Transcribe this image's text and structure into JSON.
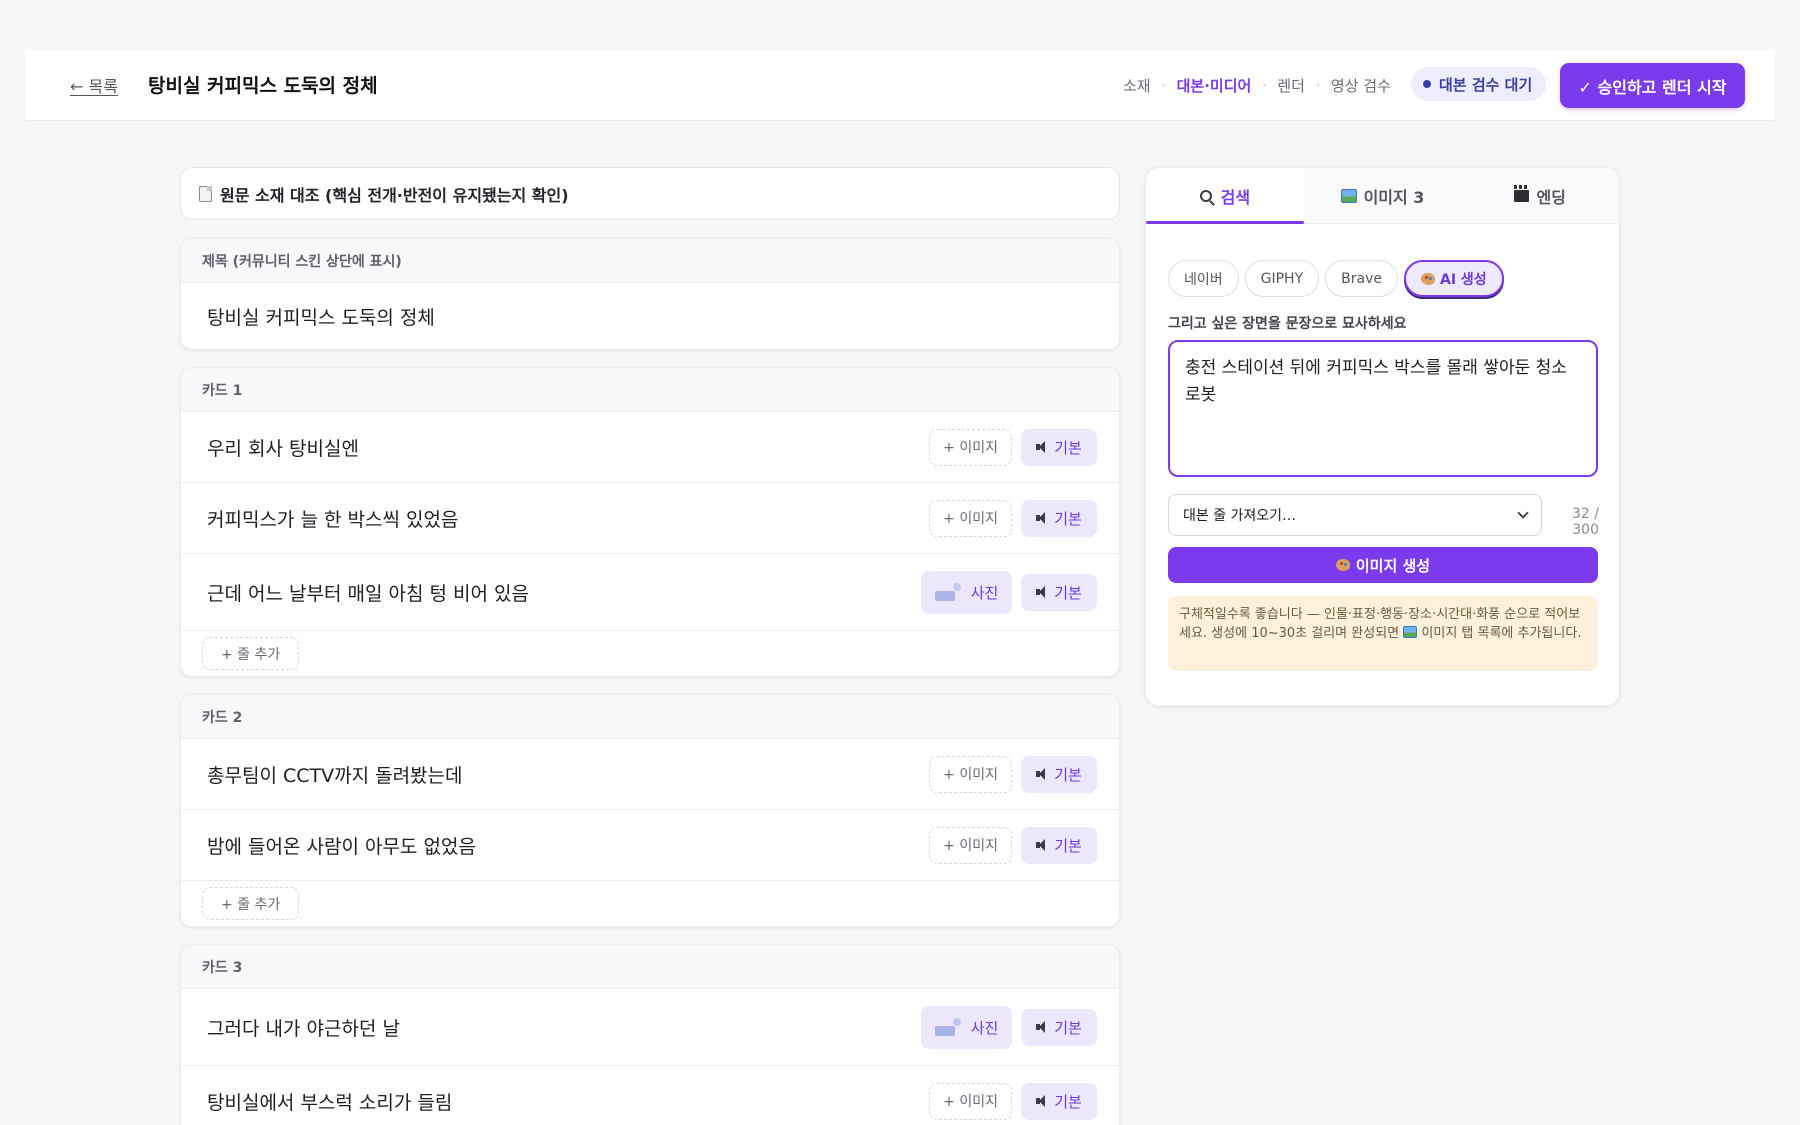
{
  "header": {
    "back_label": "← 목록",
    "title": "탕비실 커피믹스 도둑의 정체",
    "steps": [
      "소재",
      "대본·미디어",
      "렌더",
      "영상 검수"
    ],
    "active_step": "대본·미디어",
    "status": "대본 검수 대기",
    "approve_label": "✓ 승인하고 렌더 시작"
  },
  "source_compare": {
    "label": "원문 소재 대조 (핵심 전개·반전이 유지됐는지 확인)",
    "icon": "document-icon"
  },
  "title_card": {
    "header": "제목 (커뮤니티 스킨 상단에 표시)",
    "value": "탕비실 커피믹스 도둑의 정체"
  },
  "cards": [
    {
      "header": "카드 1",
      "lines": [
        {
          "text": "우리 회사 탕비실엔",
          "media": "+ 이미지",
          "voice": "기본"
        },
        {
          "text": "커피믹스가 늘 한 박스씩 있었음",
          "media": "+ 이미지",
          "voice": "기본"
        },
        {
          "text": "근데 어느 날부터 매일 아침 텅 비어 있음",
          "media": "사진",
          "voice": "기본"
        }
      ],
      "add_label": "+ 줄 추가"
    },
    {
      "header": "카드 2",
      "lines": [
        {
          "text": "총무팀이 CCTV까지 돌려봤는데",
          "media": "+ 이미지",
          "voice": "기본"
        },
        {
          "text": "밤에 들어온 사람이 아무도 없었음",
          "media": "+ 이미지",
          "voice": "기본"
        }
      ],
      "add_label": "+ 줄 추가"
    },
    {
      "header": "카드 3",
      "lines": [
        {
          "text": "그러다 내가 야근하던 날",
          "media": "사진",
          "voice": "기본"
        },
        {
          "text": "탕비실에서 부스럭 소리가 들림",
          "media": "+ 이미지",
          "voice": "기본"
        }
      ]
    }
  ],
  "panel": {
    "tabs": [
      {
        "label": "검색",
        "icon": "search-icon"
      },
      {
        "label": "이미지 3",
        "icon": "image-icon"
      },
      {
        "label": "엔딩",
        "icon": "clapper-icon"
      }
    ],
    "active_tab": "검색",
    "sources": [
      "네이버",
      "GIPHY",
      "Brave",
      "AI 생성"
    ],
    "active_source": "AI 생성",
    "prompt_label": "그리고 싶은 장면을 문장으로 묘사하세요",
    "prompt_value": "충전 스테이션 뒤에 커피믹스 박스를 몰래 쌓아둔 청소 로봇",
    "line_select": "대본 줄 가져오기…",
    "char_count": "32 / 300",
    "generate_label": "이미지 생성",
    "hint_before": "구체적일수록 좋습니다 — 인물·표정·행동·장소·시간대·화풍 순으로 적어보세요. 생성에 10~30초 걸리며 완성되면 ",
    "hint_after": " 이미지 탭 목록에 추가됩니다."
  },
  "colors": {
    "accent": "#7c3aed",
    "accent_soft": "#ede7fc",
    "status": "#3b3fa6",
    "hint_bg": "#fdf1dc"
  }
}
